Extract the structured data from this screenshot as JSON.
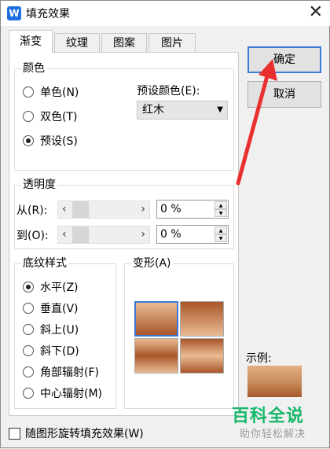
{
  "window": {
    "title": "填充效果",
    "app_icon_letter": "W",
    "close_glyph": "✕"
  },
  "tabs": [
    {
      "label": "渐变",
      "active": true
    },
    {
      "label": "纹理",
      "active": false
    },
    {
      "label": "图案",
      "active": false
    },
    {
      "label": "图片",
      "active": false
    }
  ],
  "colors_group": {
    "legend": "颜色",
    "options": [
      {
        "label": "单色(N)",
        "selected": false
      },
      {
        "label": "双色(T)",
        "selected": false
      },
      {
        "label": "预设(S)",
        "selected": true
      }
    ],
    "preset_label": "预设颜色(E):",
    "preset_value": "红木"
  },
  "transparency": {
    "legend": "透明度",
    "from_label": "从(R):",
    "to_label": "到(O):",
    "from_value": "0 %",
    "to_value": "0 %",
    "left_arrow": "‹",
    "right_arrow": "›"
  },
  "shading": {
    "legend": "底纹样式",
    "options": [
      {
        "label": "水平(Z)",
        "selected": true
      },
      {
        "label": "垂直(V)",
        "selected": false
      },
      {
        "label": "斜上(U)",
        "selected": false
      },
      {
        "label": "斜下(D)",
        "selected": false
      },
      {
        "label": "角部辐射(F)",
        "selected": false
      },
      {
        "label": "中心辐射(M)",
        "selected": false
      }
    ]
  },
  "variants": {
    "legend": "变形(A)",
    "selected_index": 0
  },
  "buttons": {
    "ok": "确定",
    "cancel": "取消"
  },
  "sample_label": "示例:",
  "rotate_checkbox": {
    "label": "随图形旋转填充效果(W)",
    "checked": false
  },
  "watermark": {
    "line1": "百科全说",
    "line2": "助你轻松解决"
  },
  "annotation_color": "#e8312f",
  "gradient_colors": [
    "#e9bb93",
    "#a8562a"
  ]
}
